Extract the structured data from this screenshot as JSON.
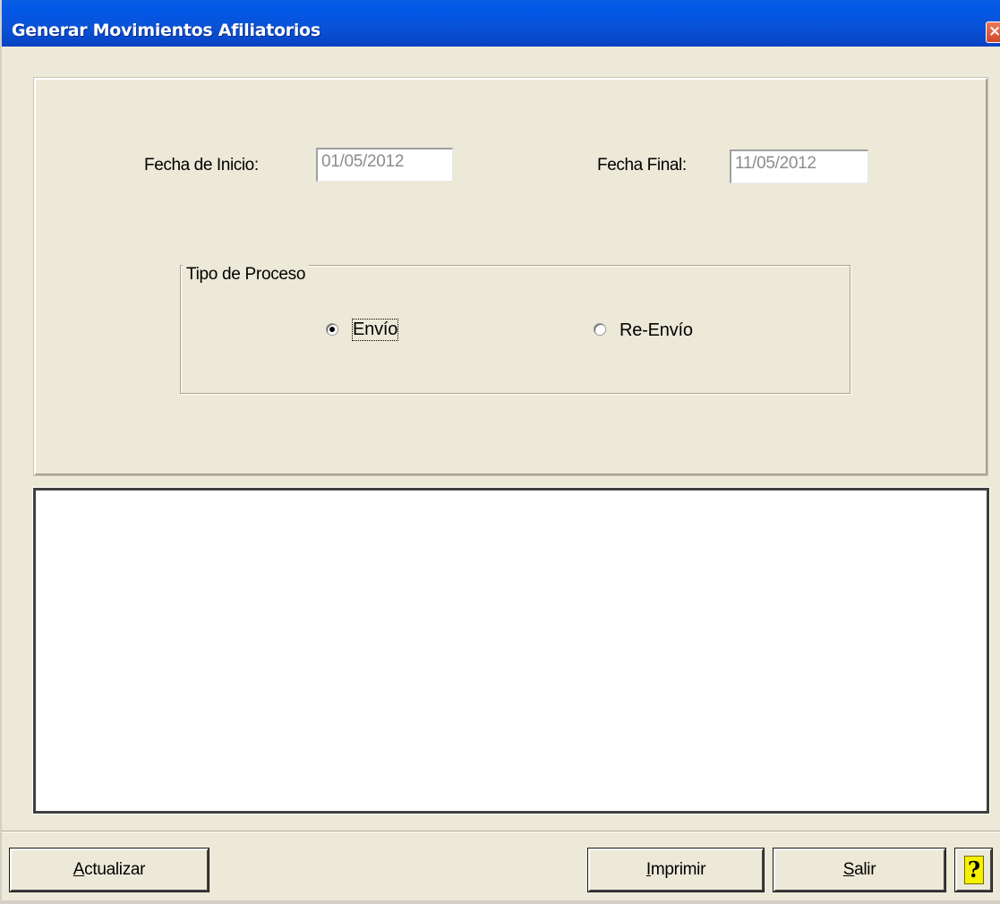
{
  "window": {
    "title": "Generar Movimientos Afiliatorios",
    "close_glyph": "×"
  },
  "dates": {
    "start_label": "Fecha de Inicio:",
    "start_value": "01/05/2012",
    "end_label": "Fecha Final:",
    "end_value": "11/05/2012"
  },
  "process_type": {
    "legend": "Tipo de Proceso",
    "options": [
      {
        "label": "Envío",
        "selected": true
      },
      {
        "label": "Re-Envío",
        "selected": false
      }
    ]
  },
  "buttons": {
    "refresh": {
      "access_key": "A",
      "rest": "ctualizar"
    },
    "print": {
      "access_key": "I",
      "rest": "mprimir"
    },
    "exit": {
      "access_key": "S",
      "rest": "alir"
    },
    "help_glyph": "?"
  },
  "colors": {
    "titlebar": "#0a52d6",
    "window_bg": "#ece9d8",
    "disabled_text": "#8c8c8c",
    "help_icon": "#f7f100"
  },
  "icons": [
    "close-icon",
    "help-icon"
  ]
}
